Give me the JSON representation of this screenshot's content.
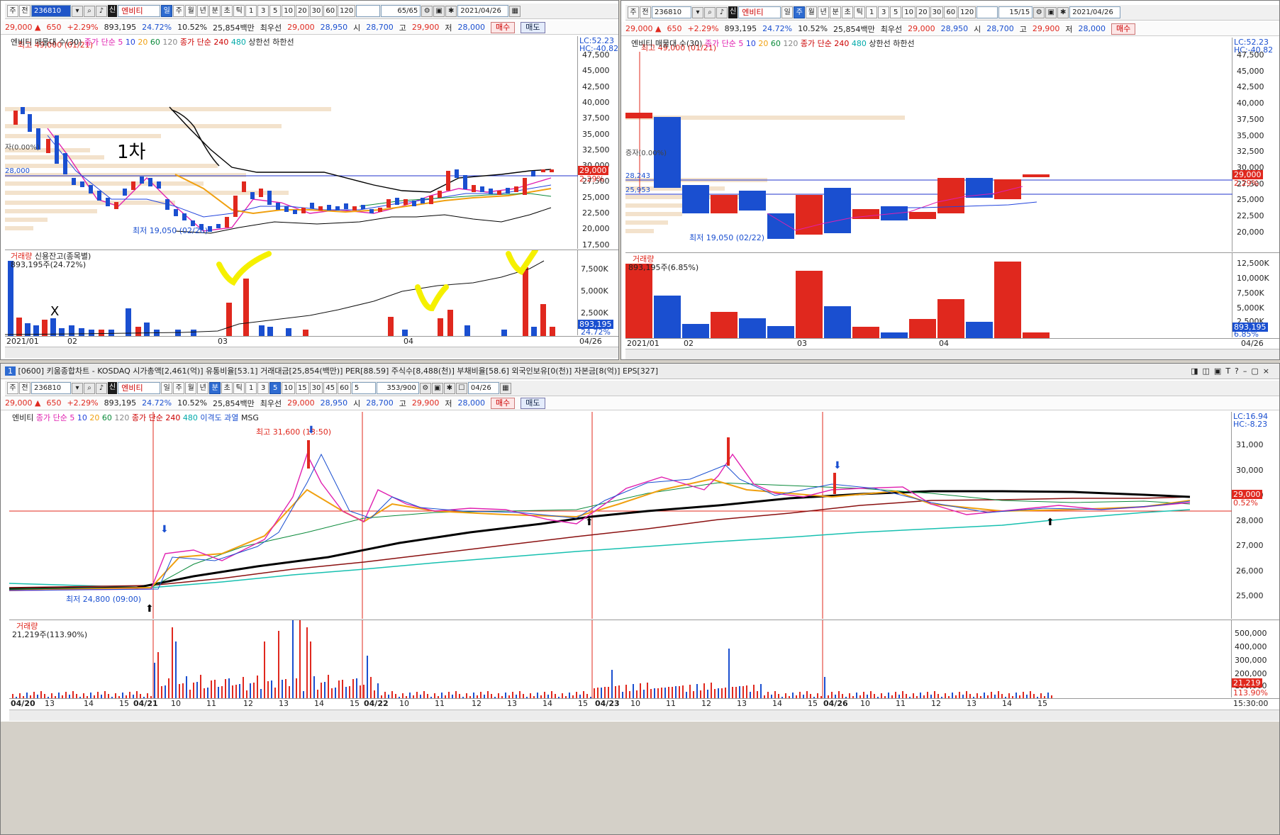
{
  "common": {
    "market_btn": "주",
    "prev_btn": "전",
    "code": "236810",
    "sin_badge": "신",
    "name": "엔비티",
    "price": "29,000",
    "change": "650",
    "change_rate": "+2.29%",
    "volume": "893,195",
    "turnover": "24.72%",
    "rate2": "10.52%",
    "amount": "25,854백만",
    "best_label": "최우선",
    "best_ask": "29,000",
    "best_bid": "28,950",
    "open_label": "시",
    "open": "28,700",
    "high_label": "고",
    "high": "29,900",
    "low_label": "저",
    "low": "28,000",
    "buy": "매수",
    "sell": "매도",
    "up_arrow": "▲"
  },
  "top_left": {
    "period_tabs": [
      "일",
      "주",
      "월",
      "년",
      "분",
      "초",
      "틱"
    ],
    "selected_period": "일",
    "num_tabs": [
      "1",
      "3",
      "5",
      "10",
      "20",
      "30",
      "60",
      "120"
    ],
    "count": "65/65",
    "date": "2021/04/26",
    "legend": {
      "title": "엔비티 매물대 수(30)",
      "ma_label": "종가 단순",
      "ma_values": [
        "5",
        "10",
        "20",
        "60",
        "120"
      ],
      "ma2_label": "종가 단순 240",
      "ma2_value": "480",
      "bands": "상한선 하한선"
    },
    "lc": "LC:52.23",
    "hc": "HC:-40.82",
    "high_note": "최고 49,000 (01/21)",
    "low_note": "최저 19,050 (02/26)",
    "left_mark": "자(0.00%)",
    "price_line": "28,000",
    "price_tag": "29,000",
    "price_tag2": "2.29%",
    "hand_note": "1차",
    "hand_x": "X",
    "y_ticks": [
      "47,500",
      "45,000",
      "42,500",
      "40,000",
      "37,500",
      "35,000",
      "32,500",
      "30,000",
      "27,500",
      "25,000",
      "22,500",
      "20,000",
      "17,500"
    ],
    "vol_legend_a": "거래량",
    "vol_legend_b": "신용잔고(종목별)",
    "vol_value": "893,195주(24.72%)",
    "vol_ticks": [
      "7,500K",
      "5,000K",
      "2,500K"
    ],
    "vol_tag": "893,195",
    "vol_tag2": "24.72%",
    "x_labels": [
      "2021/01",
      "02",
      "03",
      "04"
    ],
    "x_right": "04/26"
  },
  "top_right": {
    "period_tabs": [
      "일",
      "주",
      "월",
      "년",
      "분",
      "초",
      "틱"
    ],
    "selected_period": "주",
    "num_tabs": [
      "1",
      "3",
      "5",
      "10",
      "20",
      "30",
      "60",
      "120"
    ],
    "count": "15/15",
    "date": "2021/04/26",
    "legend": {
      "title": "엔비티 매물대 수(30)",
      "ma_label": "종가 단순",
      "ma_values": [
        "5",
        "10",
        "20",
        "60",
        "120"
      ],
      "ma2_label": "종가 단순 240",
      "ma2_value": "480",
      "bands": "상한선 하한선"
    },
    "lc": "LC:52.23",
    "hc": "HC:-40.82",
    "high_note": "최고 49,000 (01/21)",
    "low_note": "최저 19,050 (02/22)",
    "left_mark": "증자(0.00%)",
    "line1": "28,243",
    "line2": "25,953",
    "price_tag": "29,000",
    "price_tag2": "2.29%",
    "y_ticks": [
      "47,500",
      "45,000",
      "42,500",
      "40,000",
      "37,500",
      "35,000",
      "32,500",
      "30,000",
      "27,500",
      "25,000",
      "22,500",
      "20,000"
    ],
    "vol_legend_a": "거래량",
    "vol_value": "893,195주(6.85%)",
    "vol_ticks": [
      "12,500K",
      "10,000K",
      "7,500K",
      "5,000K",
      "2,500K"
    ],
    "vol_tag": "893,195",
    "vol_tag2": "6.85%",
    "x_labels": [
      "2021/01",
      "02",
      "03",
      "04"
    ],
    "x_right": "04/26"
  },
  "bottom": {
    "window_num": "1",
    "header": "[0600] 키움종합차트 - KOSDAQ 시가총액[2,461(억)] 유통비율[53.1] 거래대금[25,854(백만)] PER[88.59] 주식수[8,488(천)] 부채비율[58.6] 외국인보유[0(천)] 자본금[8(억)] EPS[327]",
    "period_tabs": [
      "일",
      "주",
      "월",
      "년",
      "분",
      "초",
      "틱"
    ],
    "selected_period": "분",
    "num_tabs": [
      "1",
      "3",
      "5",
      "10",
      "15",
      "30",
      "45",
      "60"
    ],
    "selected_num": "5",
    "interval_value": "5",
    "count": "353/900",
    "date": "04/26",
    "legend": {
      "name": "엔비티",
      "ma_label": "종가 단순",
      "ma_values": [
        "5",
        "10",
        "20",
        "60",
        "120"
      ],
      "ma2_label": "종가 단순 240",
      "ma2_value": "480",
      "extra": "이격도 과열",
      "msg": "MSG"
    },
    "lc": "LC:16.94",
    "hc": "HC:-8.23",
    "high_note": "최고 31,600 (13:50)",
    "low_note": "최저 24,800 (09:00)",
    "price_tag": "29,000",
    "price_tag2": "0.52%",
    "y_ticks": [
      "31,000",
      "30,000",
      "29,000",
      "28,000",
      "27,000",
      "26,000",
      "25,000"
    ],
    "vol_legend": "거래량",
    "vol_value": "21,219주(113.90%)",
    "vol_ticks": [
      "500,000",
      "400,000",
      "300,000",
      "200,000",
      "100,000"
    ],
    "vol_tag": "21,219",
    "vol_tag2": "113.90%",
    "x_labels": [
      "04/20",
      "13",
      "14",
      "15",
      "04/21",
      "10",
      "11",
      "12",
      "13",
      "14",
      "15",
      "04/22",
      "10",
      "11",
      "12",
      "13",
      "14",
      "15",
      "04/23",
      "10",
      "11",
      "12",
      "13",
      "14",
      "15",
      "04/26",
      "10",
      "11",
      "12",
      "13",
      "14",
      "15"
    ],
    "x_right": "15:30:00"
  }
}
